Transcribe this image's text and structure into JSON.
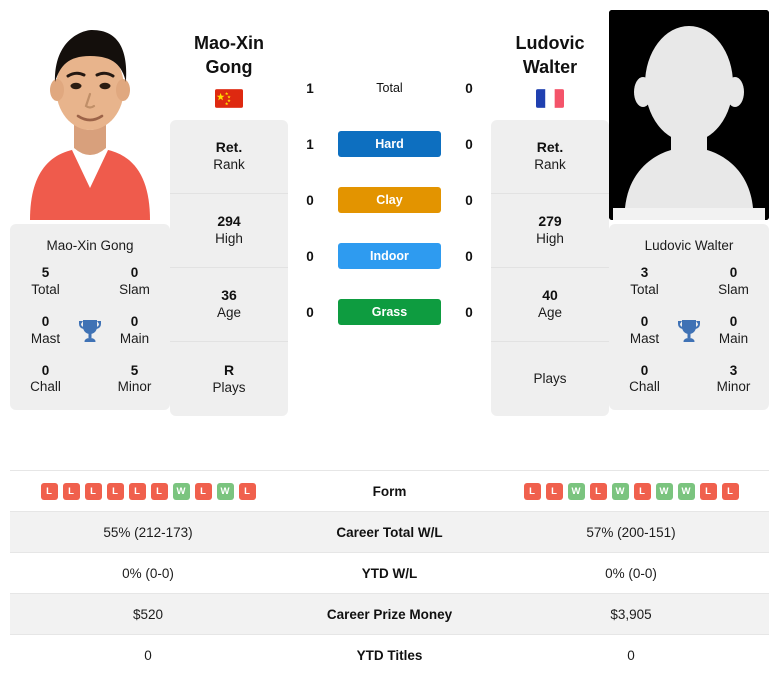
{
  "players": {
    "left": {
      "first_name": "Mao-Xin",
      "last_name": "Gong",
      "full_name": "Mao-Xin Gong",
      "flag": "cn-flag-icon",
      "photo": "player-photo",
      "titles": {
        "total_value": "5",
        "total_label": "Total",
        "slam_value": "0",
        "slam_label": "Slam",
        "mast_value": "0",
        "mast_label": "Mast",
        "main_value": "0",
        "main_label": "Main",
        "chall_value": "0",
        "chall_label": "Chall",
        "minor_value": "5",
        "minor_label": "Minor"
      },
      "ranks": [
        {
          "value": "Ret.",
          "label": "Rank"
        },
        {
          "value": "294",
          "label": "High"
        },
        {
          "value": "36",
          "label": "Age"
        },
        {
          "value": "R",
          "label": "Plays"
        }
      ],
      "surface_values": {
        "total": "1",
        "hard": "1",
        "clay": "0",
        "indoor": "0",
        "grass": "0"
      },
      "form": [
        "L",
        "L",
        "L",
        "L",
        "L",
        "L",
        "W",
        "L",
        "W",
        "L"
      ],
      "career_total_wl": "55% (212-173)",
      "ytd_wl": "0% (0-0)",
      "career_prize_money": "$520",
      "ytd_titles": "0"
    },
    "right": {
      "first_name": "Ludovic",
      "last_name": "Walter",
      "full_name": "Ludovic Walter",
      "flag": "fr-flag-icon",
      "photo": "player-photo-placeholder",
      "titles": {
        "total_value": "3",
        "total_label": "Total",
        "slam_value": "0",
        "slam_label": "Slam",
        "mast_value": "0",
        "mast_label": "Mast",
        "main_value": "0",
        "main_label": "Main",
        "chall_value": "0",
        "chall_label": "Chall",
        "minor_value": "3",
        "minor_label": "Minor"
      },
      "ranks": [
        {
          "value": "Ret.",
          "label": "Rank"
        },
        {
          "value": "279",
          "label": "High"
        },
        {
          "value": "40",
          "label": "Age"
        },
        {
          "value": "",
          "label": "Plays"
        }
      ],
      "surface_values": {
        "total": "0",
        "hard": "0",
        "clay": "0",
        "indoor": "0",
        "grass": "0"
      },
      "form": [
        "L",
        "L",
        "W",
        "L",
        "W",
        "L",
        "W",
        "W",
        "L",
        "L"
      ],
      "career_total_wl": "57% (200-151)",
      "ytd_wl": "0% (0-0)",
      "career_prize_money": "$3,905",
      "ytd_titles": "0"
    }
  },
  "surfaces": [
    {
      "key": "total",
      "label": "Total",
      "color": "",
      "pill": false
    },
    {
      "key": "hard",
      "label": "Hard",
      "color": "#0d6fc0",
      "pill": true
    },
    {
      "key": "clay",
      "label": "Clay",
      "color": "#e39400",
      "pill": true
    },
    {
      "key": "indoor",
      "label": "Indoor",
      "color": "#2e9bf0",
      "pill": true
    },
    {
      "key": "grass",
      "label": "Grass",
      "color": "#0e9c40",
      "pill": true
    }
  ],
  "table_rows": [
    {
      "label": "Form",
      "type": "form"
    },
    {
      "label": "Career Total W/L",
      "type": "text",
      "key": "career_total_wl"
    },
    {
      "label": "YTD W/L",
      "type": "text",
      "key": "ytd_wl"
    },
    {
      "label": "Career Prize Money",
      "type": "text",
      "key": "career_prize_money"
    },
    {
      "label": "YTD Titles",
      "type": "text",
      "key": "ytd_titles"
    }
  ],
  "colors": {
    "win_badge": "#7bc47f",
    "loss_badge": "#f0604d",
    "trophy": "#3f72b5",
    "panel_bg": "#efefef",
    "row_alt_bg": "#f2f2f2"
  },
  "icons": {
    "trophy": "trophy-icon"
  }
}
